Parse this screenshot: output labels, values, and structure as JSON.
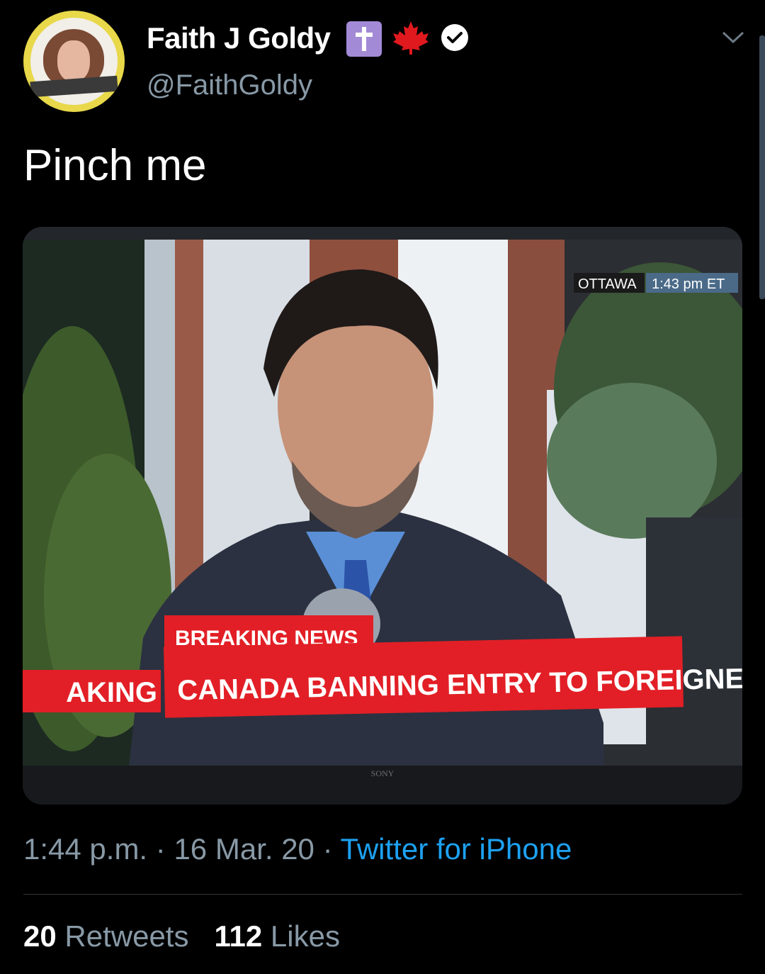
{
  "author": {
    "display_name": "Faith J Goldy",
    "handle": "@FaithGoldy",
    "badges": [
      "cross-icon",
      "maple-leaf-icon",
      "verified-icon"
    ]
  },
  "tweet": {
    "text": "Pinch me"
  },
  "media": {
    "location_label": "OTTAWA",
    "time_label": "1:43 pm ET",
    "breaking_label": "BREAKING NEWS",
    "headline": "CANADA BANNING ENTRY TO FOREIGNERS",
    "side_label": "AKING",
    "tv_brand": "SONY"
  },
  "meta": {
    "time": "1:44 p.m.",
    "separator": "·",
    "date": "16 Mar. 20",
    "source": "Twitter for iPhone"
  },
  "stats": {
    "retweets_count": "20",
    "retweets_label": "Retweets",
    "likes_count": "112",
    "likes_label": "Likes"
  },
  "colors": {
    "background": "#000000",
    "secondary_text": "#8899a6",
    "link": "#1da1f2",
    "breaking_red": "#e21f26"
  }
}
